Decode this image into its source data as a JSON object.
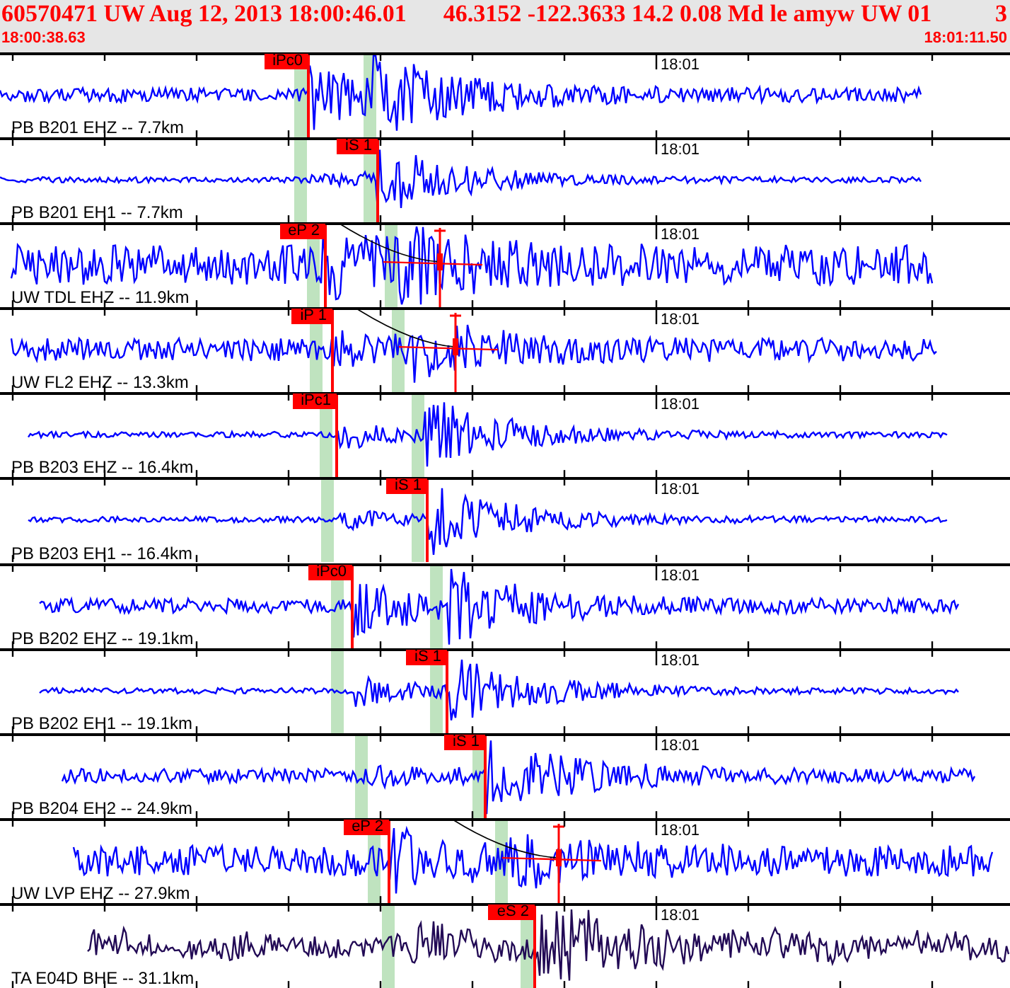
{
  "header": {
    "event": "60570471 UW Aug 12, 2013 18:00:46.01",
    "solution": "46.3152 -122.3633 14.2 0.08 Md le amyw UW 01",
    "count": "3",
    "start_time": "18:00:38.63",
    "end_time": "18:01:11.50"
  },
  "traces": [
    {
      "station": "PB B201 EHZ -- 7.7km",
      "pick": "iPc0",
      "time_mark": "18:01",
      "color": "#0000ff"
    },
    {
      "station": "PB B201 EH1 -- 7.7km",
      "pick": "iS 1",
      "time_mark": "18:01",
      "color": "#0000ff"
    },
    {
      "station": "UW TDL EHZ -- 11.9km",
      "pick": "eP 2",
      "time_mark": "18:01",
      "color": "#0000ff"
    },
    {
      "station": "UW FL2 EHZ -- 13.3km",
      "pick": "iP 1",
      "time_mark": "18:01",
      "color": "#0000ff"
    },
    {
      "station": "PB B203 EHZ -- 16.4km",
      "pick": "iPc1",
      "time_mark": "18:01",
      "color": "#0000ff"
    },
    {
      "station": "PB B203 EH1 -- 16.4km",
      "pick": "iS 1",
      "time_mark": "18:01",
      "color": "#0000ff"
    },
    {
      "station": "PB B202 EHZ -- 19.1km",
      "pick": "iPc0",
      "time_mark": "18:01",
      "color": "#0000ff"
    },
    {
      "station": "PB B202 EH1 -- 19.1km",
      "pick": "iS 1",
      "time_mark": "18:01",
      "color": "#0000ff"
    },
    {
      "station": "PB B204 EH2 -- 24.9km",
      "pick": "iS 1",
      "time_mark": "18:01",
      "color": "#0000ff"
    },
    {
      "station": "UW LVP EHZ -- 27.9km",
      "pick": "eP 2",
      "time_mark": "18:01",
      "color": "#0000ff"
    },
    {
      "station": "TA E04D BHE -- 31.1km",
      "pick": "eS 2",
      "time_mark": "18:01",
      "color": "#220a55"
    }
  ]
}
